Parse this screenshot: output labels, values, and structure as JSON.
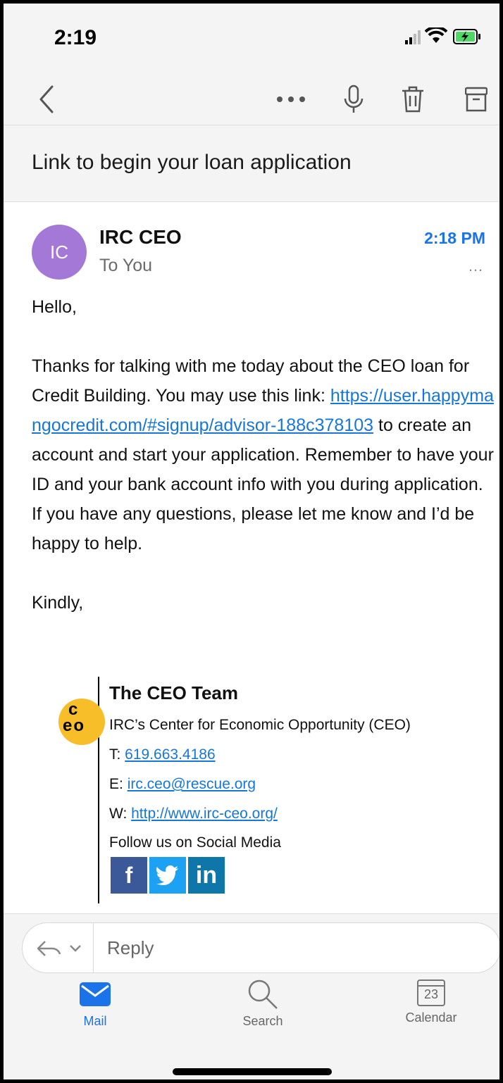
{
  "status_bar": {
    "time": "2:19"
  },
  "toolbar": {
    "back_icon": "chevron-left-icon",
    "more_icon": "ellipsis-icon",
    "mic_icon": "microphone-icon",
    "trash_icon": "trash-icon",
    "archive_icon": "archive-icon"
  },
  "subject": "Link to begin your loan application",
  "message": {
    "avatar_initials": "IC",
    "avatar_color": "#a378d6",
    "sender": "IRC CEO",
    "recipient": "To You",
    "time": "2:18 PM",
    "more": "…",
    "greeting": "Hello,",
    "body_intro": "Thanks for talking with me today about the CEO loan for Credit Building. You may use this link: ",
    "link_text": "https://user.happymangocredit.com/#signup/advisor-188c378103",
    "body_rest": " to create an account and start your application. Remember to have your ID and your bank account info with you during application. If you have any questions, please let me know and I’d be happy to help.",
    "closing": "Kindly,"
  },
  "signature": {
    "logo_letters_top": "c",
    "logo_letters_bottom": "eo",
    "team": "The CEO Team",
    "org": "IRC’s Center for Economic Opportunity (CEO)",
    "phone_label": "T: ",
    "phone": "619.663.4186",
    "email_label": "E: ",
    "email": "irc.ceo@rescue.org",
    "web_label": "W: ",
    "web": "http://www.irc-ceo.org/",
    "follow": "Follow us on Social Media",
    "social": [
      {
        "icon": "facebook-icon",
        "glyph": "f",
        "color": "#3b5998"
      },
      {
        "icon": "twitter-icon",
        "glyph": "t",
        "color": "#1da1f2"
      },
      {
        "icon": "linkedin-icon",
        "glyph": "in",
        "color": "#0e76a8"
      }
    ]
  },
  "reply": {
    "placeholder": "Reply"
  },
  "tabs": [
    {
      "label": "Mail",
      "icon": "mail-icon",
      "active": true
    },
    {
      "label": "Search",
      "icon": "search-icon",
      "active": false
    },
    {
      "label": "Calendar",
      "icon": "calendar-icon",
      "active": false,
      "date": "23"
    }
  ],
  "colors": {
    "accent": "#1677d9",
    "active_tab": "#1a73e8"
  }
}
